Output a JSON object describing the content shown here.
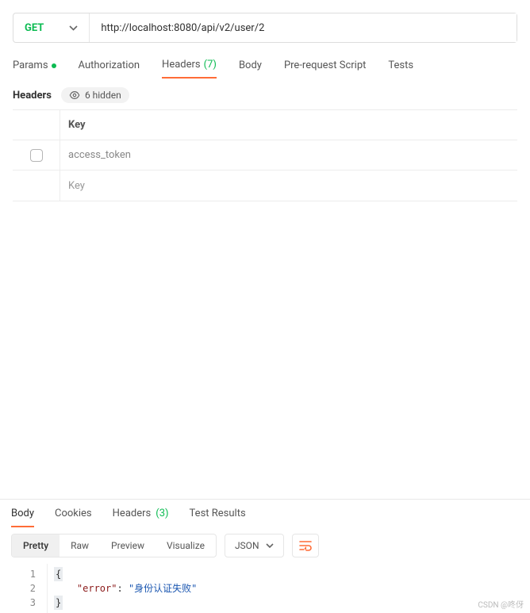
{
  "request": {
    "method": "GET",
    "url": "http://localhost:8080/api/v2/user/2"
  },
  "tabs": {
    "params": "Params",
    "params_active": true,
    "authorization": "Authorization",
    "headers_label": "Headers",
    "headers_count": "(7)",
    "body": "Body",
    "prerequest": "Pre-request Script",
    "tests": "Tests",
    "selected": "Headers"
  },
  "headers_section": {
    "title": "Headers",
    "hidden_label": "6 hidden",
    "column_key": "Key",
    "rows": [
      {
        "key": "access_token",
        "checked": false
      }
    ],
    "placeholder_key": "Key"
  },
  "response_tabs": {
    "body": "Body",
    "cookies": "Cookies",
    "headers_label": "Headers",
    "headers_count": "(3)",
    "test_results": "Test Results",
    "selected": "Body"
  },
  "view_modes": {
    "pretty": "Pretty",
    "raw": "Raw",
    "preview": "Preview",
    "visualize": "Visualize",
    "selected": "Pretty"
  },
  "format_select": {
    "value": "JSON"
  },
  "response_body": {
    "lines": [
      "{",
      "    \"error\": \"身份认证失败\"",
      "}"
    ],
    "error_key": "\"error\"",
    "error_val": "\"身份认证失败\""
  },
  "watermark": "CSDN @咚伢"
}
